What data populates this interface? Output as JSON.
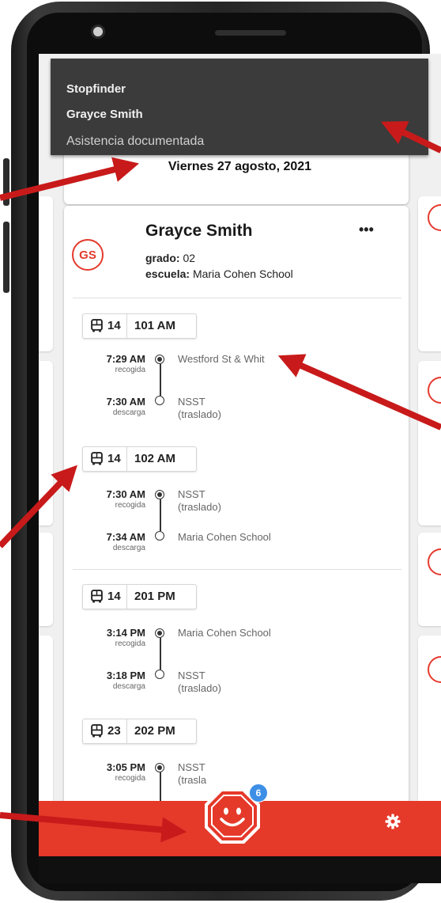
{
  "notification": {
    "app_name": "Stopfinder",
    "student_name": "Grayce Smith",
    "message": "Asistencia documentada"
  },
  "date_header": {
    "date": "Viernes 27 agosto, 2021"
  },
  "student": {
    "initials": "GS",
    "name": "Grayce Smith",
    "more_label": "•••",
    "grade_label": "grado:",
    "grade_value": "02",
    "school_label": "escuela:",
    "school_value": "Maria Cohen School"
  },
  "trips": [
    {
      "bus_number": "14",
      "route_name": "101 AM",
      "pickup": {
        "time": "7:29 AM",
        "kind": "recogida",
        "stop": "Westford St & Whit",
        "stop_sub": ""
      },
      "dropoff": {
        "time": "7:30 AM",
        "kind": "descarga",
        "stop": "NSST",
        "stop_sub": "(traslado)"
      }
    },
    {
      "bus_number": "14",
      "route_name": "102 AM",
      "pickup": {
        "time": "7:30 AM",
        "kind": "recogida",
        "stop": "NSST",
        "stop_sub": "(traslado)"
      },
      "dropoff": {
        "time": "7:34 AM",
        "kind": "descarga",
        "stop": "Maria Cohen School",
        "stop_sub": ""
      }
    },
    {
      "bus_number": "14",
      "route_name": "201 PM",
      "pickup": {
        "time": "3:14 PM",
        "kind": "recogida",
        "stop": "Maria Cohen School",
        "stop_sub": ""
      },
      "dropoff": {
        "time": "3:18 PM",
        "kind": "descarga",
        "stop": "NSST",
        "stop_sub": "(traslado)"
      }
    },
    {
      "bus_number": "23",
      "route_name": "202 PM",
      "pickup": {
        "time": "3:05 PM",
        "kind": "recogida",
        "stop": "NSST",
        "stop_sub": "(trasla"
      }
    }
  ],
  "bottom_bar": {
    "badge_count": "6",
    "gear_icon": "gear-icon",
    "stop_icon": "smiley-stop-sign-icon"
  },
  "colors": {
    "accent_red": "#e5392a",
    "badge_blue": "#3d8fe6",
    "notification_bg": "#3b3b3b",
    "annotation_arrow": "#c81a1a"
  }
}
